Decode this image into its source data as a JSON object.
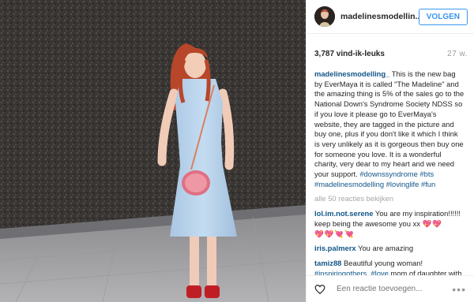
{
  "post": {
    "username": "madelinesmodellin...",
    "follow_label": "VOLGEN",
    "likes": "3,787 vind-ik-leuks",
    "time": "27 w."
  },
  "caption": {
    "username": "madelinesmodelling_",
    "text": " This is the new bag by EverMaya it is called \"The Madeline\" and the amazing thing is 5% of the sales go to the National Down's Syndrome Society NDSS so if you love it please go to EverMaya's website, they are tagged in the picture and buy one, plus if you don't like it which I think is very unlikely as it is gorgeous then buy one for someone you love. It is a wonderful charity, very dear to my heart and we need your support. ",
    "tags": "#downssyndrome #bts #madelinesmodelling #lovinglife #fun"
  },
  "view_all": "alle 50 reacties bekijken",
  "comments": [
    {
      "user": "lol.im.not.serene",
      "text": " You are my inspiration!!!!!! keep being the awesome you xx ",
      "hearts": "💖💖"
    },
    {
      "user": "",
      "text": "",
      "hearts": "💖💖💘💘"
    },
    {
      "user": "iris.palmerx",
      "text": " You are amazing",
      "hearts": ""
    },
    {
      "user": "tamiz88",
      "text": " Beautiful young woman! ",
      "tags": "#inspiringothers. #love",
      "text2": " mom of daughter with Down Syndrome. Thank you! ..."
    }
  ],
  "input": {
    "placeholder": "Een reactie toevoegen...",
    "more": "•••"
  },
  "colors": {
    "accent": "#3897f0",
    "username_link": "#125688",
    "heart": "#e0245e",
    "dress": "#b7d3ec",
    "hair": "#b8462a"
  },
  "icons": {
    "like": "heart-icon",
    "options": "more-options-icon"
  }
}
